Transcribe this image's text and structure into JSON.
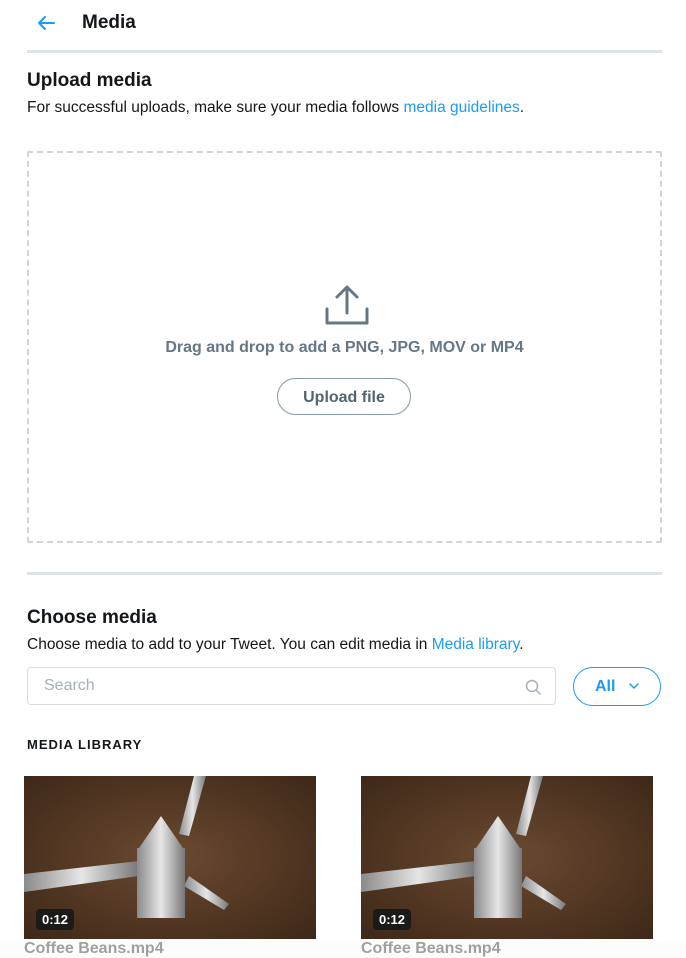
{
  "header": {
    "back_icon": "arrow-left-icon",
    "title": "Media"
  },
  "upload": {
    "heading": "Upload media",
    "description_prefix": "For successful uploads, make sure your media follows ",
    "guidelines_link": "media guidelines",
    "description_suffix": ".",
    "dropzone_icon": "upload-icon",
    "drop_text": "Drag and drop to add a PNG, JPG, MOV or MP4",
    "upload_button": "Upload file"
  },
  "choose": {
    "heading": "Choose media",
    "description_prefix": "Choose media to add to your Tweet. You can edit media in ",
    "library_link": "Media library",
    "description_suffix": ".",
    "search_placeholder": "Search",
    "search_value": "",
    "search_icon": "search-icon",
    "filter_label": "All",
    "filter_icon": "chevron-down-icon"
  },
  "library": {
    "label": "MEDIA LIBRARY",
    "items": [
      {
        "name": "Coffee Beans.mp4",
        "duration": "0:12"
      },
      {
        "name": "Coffee Beans.mp4",
        "duration": "0:12"
      }
    ]
  },
  "colors": {
    "accent": "#1d9bf0",
    "text": "#14171a",
    "muted": "#657786",
    "divider": "#dde3e7"
  }
}
